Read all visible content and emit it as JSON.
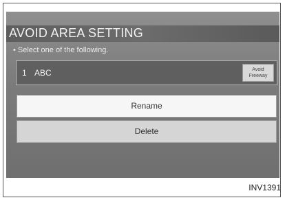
{
  "screen": {
    "title": "AVOID AREA SETTING",
    "instruction": "• Select one of the following."
  },
  "item": {
    "number": "1",
    "name": "ABC",
    "tag_line1": "Avoid",
    "tag_line2": "Freeway"
  },
  "buttons": {
    "rename": "Rename",
    "delete": "Delete"
  },
  "caption": "INV1391"
}
